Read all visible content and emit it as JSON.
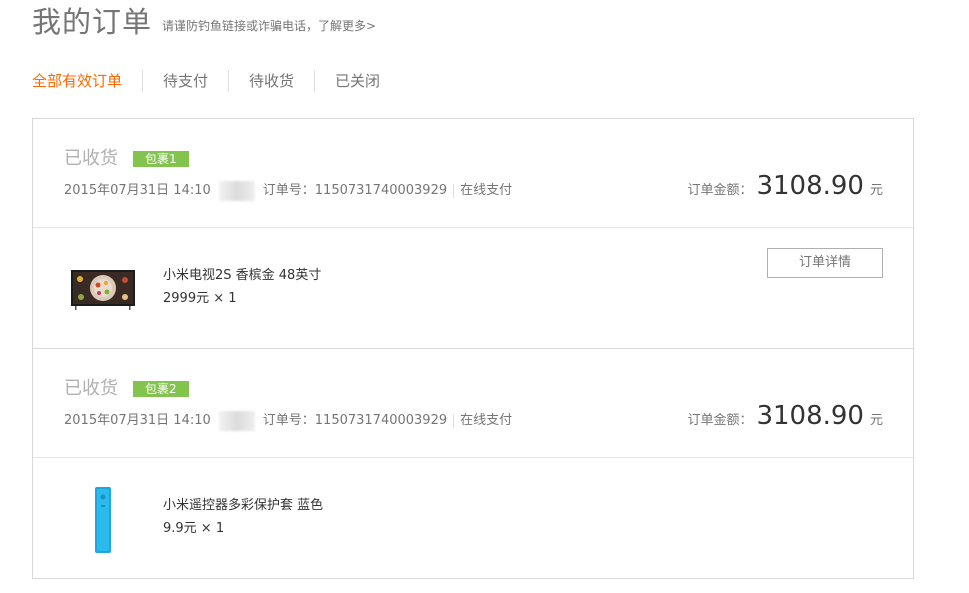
{
  "page": {
    "title": "我的订单",
    "notice": "请谨防钓鱼链接或诈骗电话，了解更多>"
  },
  "tabs": [
    {
      "label": "全部有效订单",
      "active": true
    },
    {
      "label": "待支付",
      "active": false
    },
    {
      "label": "待收货",
      "active": false
    },
    {
      "label": "已关闭",
      "active": false
    }
  ],
  "orders": [
    {
      "status": "已收货",
      "badge": "包裹1",
      "date": "2015年07月31日 14:10",
      "order_label": "订单号：",
      "order_no": "1150731740003929",
      "payment": "在线支付",
      "amount_label": "订单金额：",
      "amount": "3108.90",
      "amount_unit": "元",
      "product": {
        "name": "小米电视2S 香槟金 48英寸",
        "price": "2999元 × 1",
        "image": "tv-image"
      },
      "detail_button": "订单详情"
    },
    {
      "status": "已收货",
      "badge": "包裹2",
      "date": "2015年07月31日 14:10",
      "order_label": "订单号：",
      "order_no": "1150731740003929",
      "payment": "在线支付",
      "amount_label": "订单金额：",
      "amount": "3108.90",
      "amount_unit": "元",
      "product": {
        "name": "小米遥控器多彩保护套 蓝色",
        "price": "9.9元 × 1",
        "image": "remote-case-image"
      }
    }
  ],
  "colors": {
    "accent": "#ff6700",
    "badge": "#83c44e",
    "muted": "#757575",
    "status": "#b0b0b0"
  }
}
